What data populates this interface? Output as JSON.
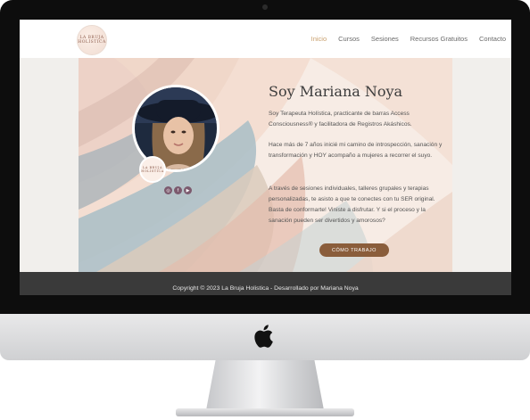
{
  "logo": {
    "line1": "LA BRUJA",
    "line2": "HOLÍSTICA"
  },
  "nav": {
    "items": [
      {
        "label": "Inicio",
        "active": true
      },
      {
        "label": "Cursos"
      },
      {
        "label": "Sesiones"
      },
      {
        "label": "Recursos Gratuitos"
      },
      {
        "label": "Contacto"
      }
    ]
  },
  "hero": {
    "title": "Soy Mariana Noya",
    "paragraph1": "Soy Terapeuta Holística, practicante de barras Access Consciousness® y facilitadora de Registros Akáshicos.",
    "paragraph2": "Hace más de 7 años inicié mi camino de introspección, sanación y transformación y HOY acompaño a mujeres a recorrer el suyo.",
    "paragraph3": "A través de sesiones individuales, talleres grupales y terapias personalizadas, te asisto a que te conectes con tu SER original. Basta de conformarte! Viniste a disfrutar. Y si el proceso y la sanación pueden ser divertidos y amorosos?",
    "cta_label": "CÓMO TRABAJO",
    "social_icons": [
      "instagram-icon",
      "facebook-icon",
      "youtube-icon"
    ]
  },
  "footer": {
    "text": "Copyright © 2023 La Bruja Holistica - Desarrollado por Mariana Noya"
  },
  "colors": {
    "accent": "#c9a06e",
    "button": "#8a5d3b",
    "footer": "#3a3a3a"
  }
}
